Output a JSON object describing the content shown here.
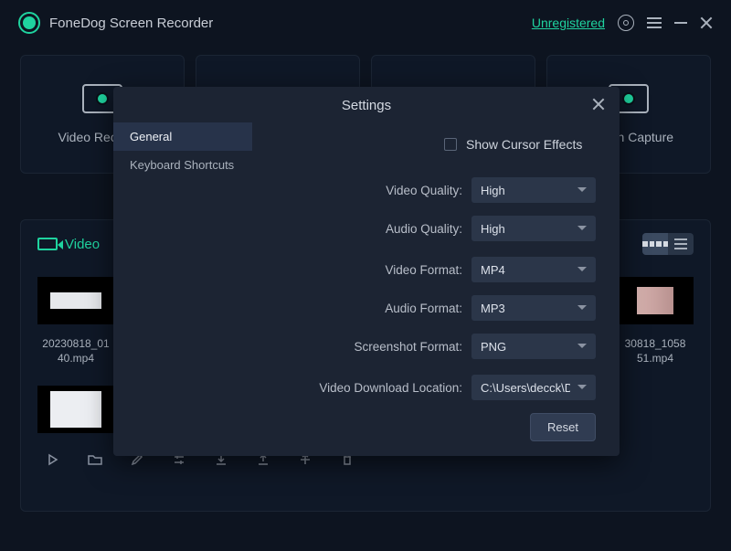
{
  "titlebar": {
    "app_name": "FoneDog Screen Recorder",
    "status": "Unregistered"
  },
  "modes": {
    "video_label": "Video Recorder",
    "capture_label": "Screen Capture"
  },
  "library": {
    "tab_video": "Video",
    "thumbs": [
      {
        "name": "20230818_01\n40.mp4"
      },
      {
        "name": "30818_1058\n51.mp4"
      }
    ]
  },
  "settings": {
    "title": "Settings",
    "sidebar": {
      "general": "General",
      "shortcuts": "Keyboard Shortcuts"
    },
    "cursor_effects_label": "Show Cursor Effects",
    "fields": {
      "video_quality_label": "Video Quality:",
      "video_quality_value": "High",
      "audio_quality_label": "Audio Quality:",
      "audio_quality_value": "High",
      "video_format_label": "Video Format:",
      "video_format_value": "MP4",
      "audio_format_label": "Audio Format:",
      "audio_format_value": "MP3",
      "screenshot_format_label": "Screenshot Format:",
      "screenshot_format_value": "PNG",
      "download_loc_label": "Video Download Location:",
      "download_loc_value": "C:\\Users\\decck\\Do"
    },
    "reset_label": "Reset"
  }
}
